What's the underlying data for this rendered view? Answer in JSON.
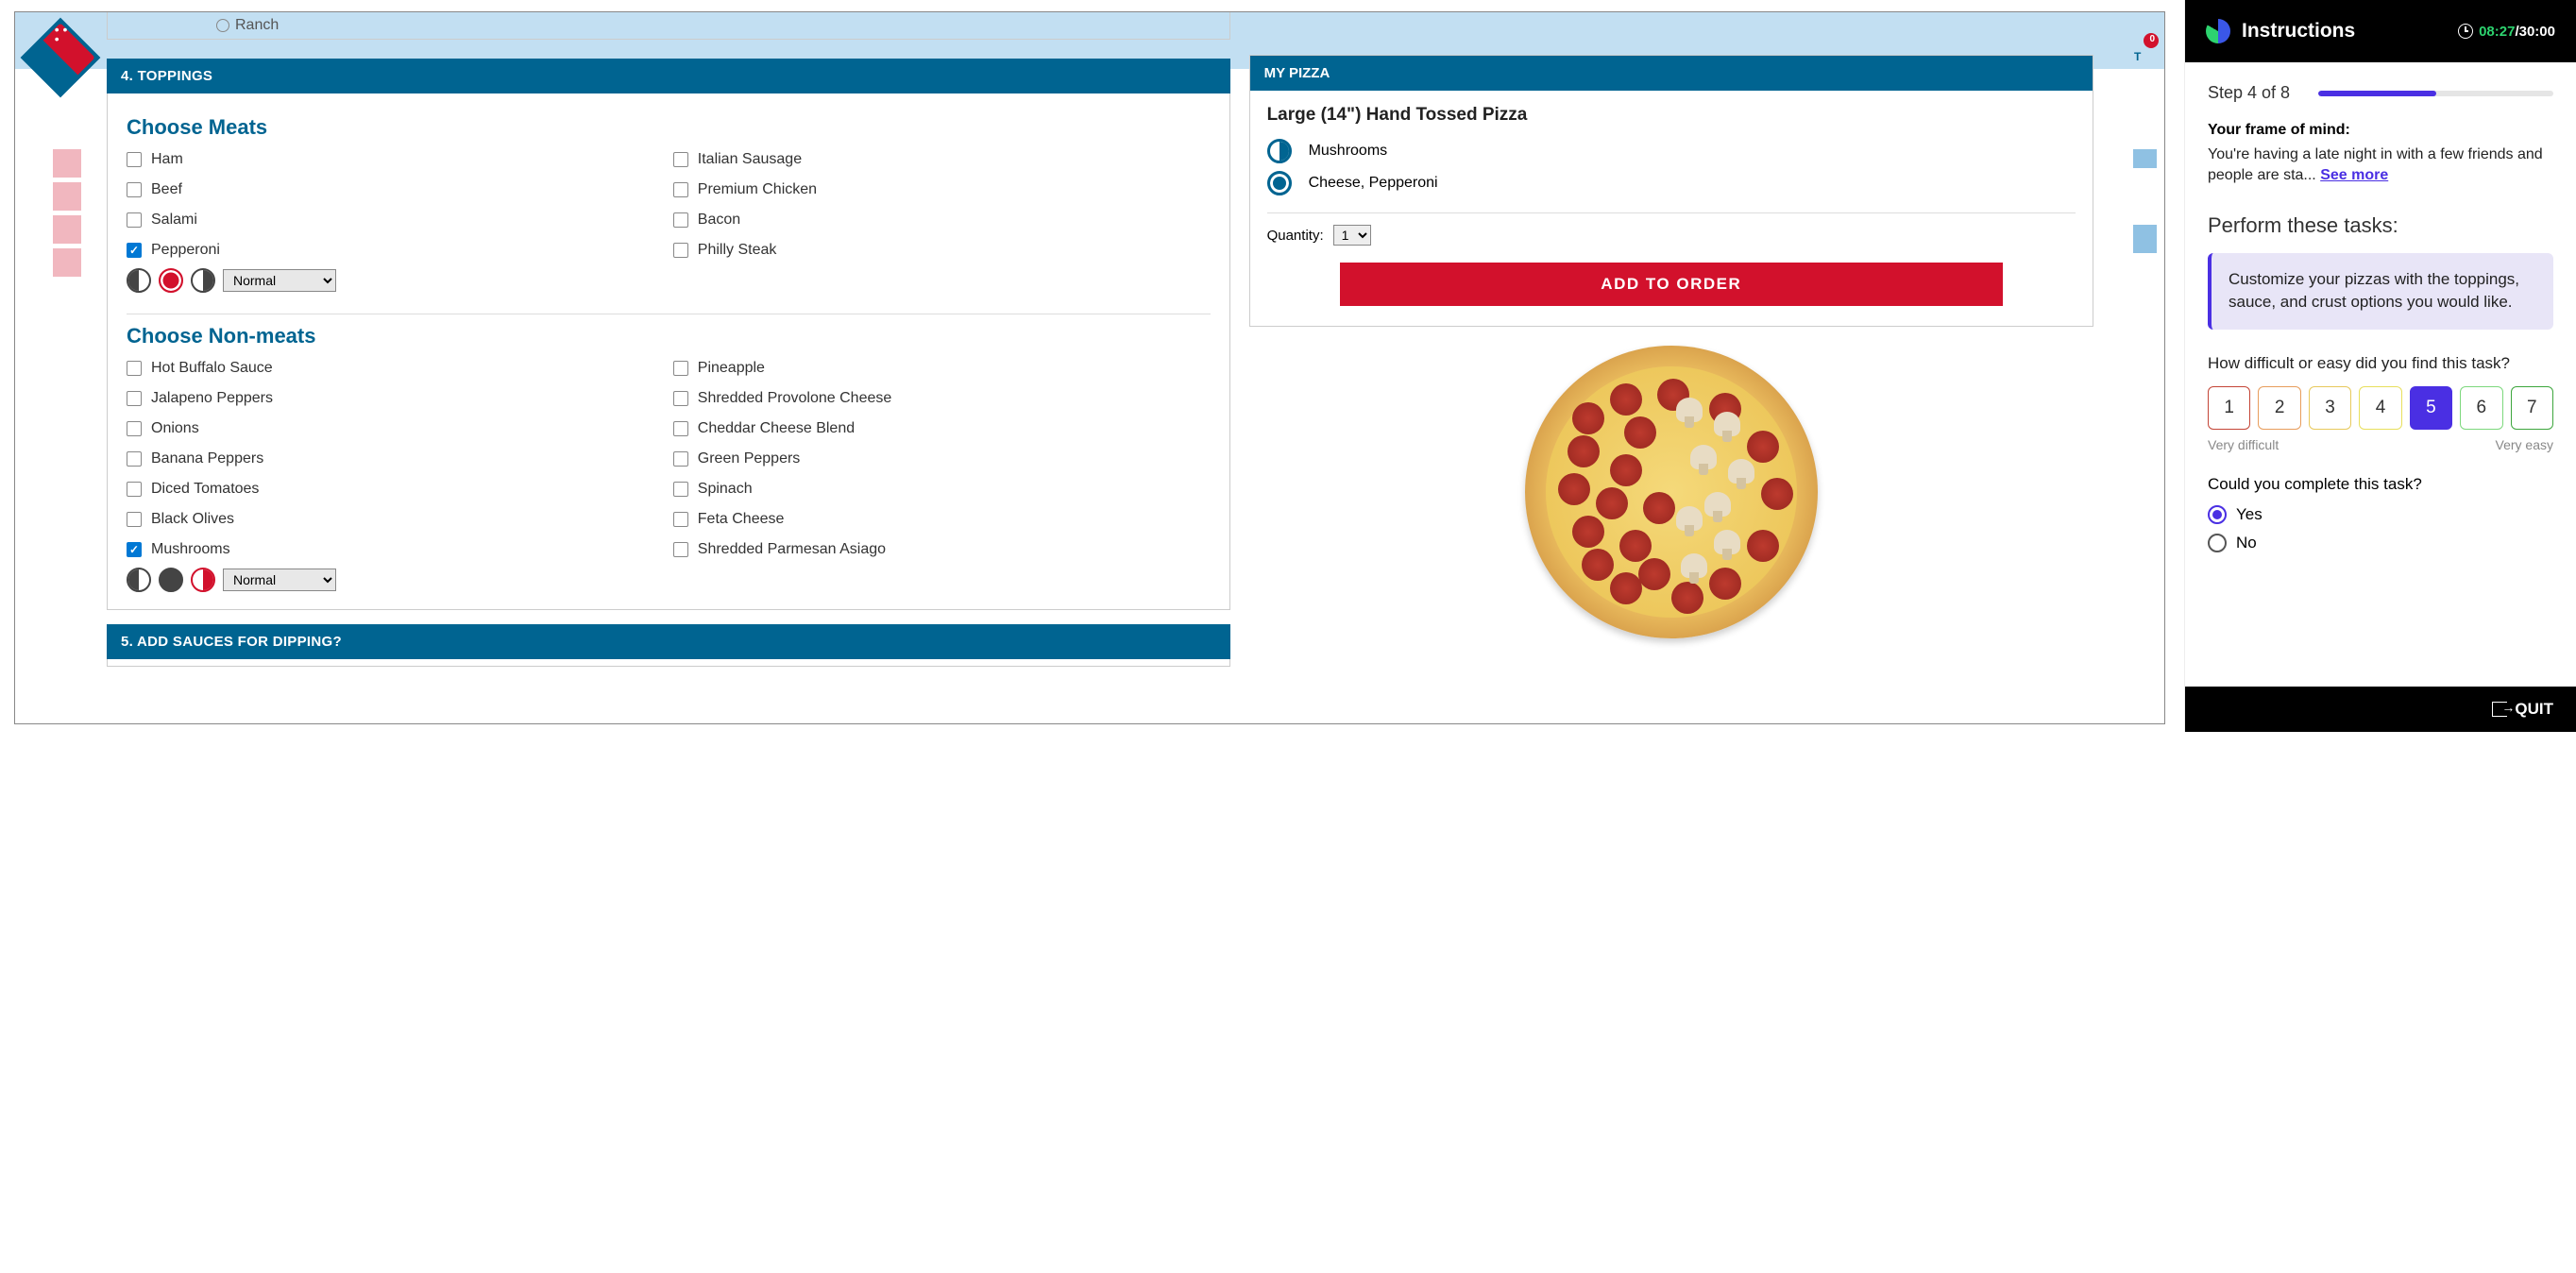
{
  "dominos": {
    "truncated_option": "Ranch",
    "cart_count": "0",
    "sections": {
      "toppings": {
        "banner": "4. TOPPINGS"
      },
      "dipping": {
        "banner": "5. ADD SAUCES FOR DIPPING?"
      }
    },
    "meats": {
      "heading": "Choose Meats",
      "items_left": [
        "Ham",
        "Beef",
        "Salami",
        "Pepperoni"
      ],
      "items_right": [
        "Italian Sausage",
        "Premium Chicken",
        "Bacon",
        "Philly Steak"
      ],
      "pepperoni_amount": "Normal"
    },
    "nonmeats": {
      "heading": "Choose Non-meats",
      "items_left": [
        "Hot Buffalo Sauce",
        "Jalapeno Peppers",
        "Onions",
        "Banana Peppers",
        "Diced Tomatoes",
        "Black Olives",
        "Mushrooms"
      ],
      "items_right": [
        "Pineapple",
        "Shredded Provolone Cheese",
        "Cheddar Cheese Blend",
        "Green Peppers",
        "Spinach",
        "Feta Cheese",
        "Shredded Parmesan Asiago"
      ],
      "mushrooms_amount": "Normal"
    }
  },
  "my_pizza": {
    "header": "MY PIZZA",
    "title": "Large (14\") Hand Tossed Pizza",
    "ingredients": [
      {
        "label": "Mushrooms",
        "coverage": "half-right"
      },
      {
        "label": "Cheese, Pepperoni",
        "coverage": "whole"
      }
    ],
    "quantity_label": "Quantity:",
    "quantity_value": "1",
    "add_button": "ADD TO ORDER"
  },
  "sidebar": {
    "title": "Instructions",
    "timer_elapsed": "08:27",
    "timer_total": "/30:00",
    "step": "Step 4 of 8",
    "frame_label": "Your frame of mind:",
    "frame_text": "You're having a late night in with a few friends and people are sta... ",
    "see_more": "See more",
    "tasks_heading": "Perform these tasks:",
    "task_text": "Customize your pizzas with the toppings, sauce, and crust options you would like.",
    "difficulty_label": "How difficult or easy did you find this task?",
    "ratings": [
      "1",
      "2",
      "3",
      "4",
      "5",
      "6",
      "7"
    ],
    "legend_left": "Very difficult",
    "legend_right": "Very easy",
    "complete_label": "Could you complete this task?",
    "yes": "Yes",
    "no": "No",
    "quit": "QUIT"
  }
}
